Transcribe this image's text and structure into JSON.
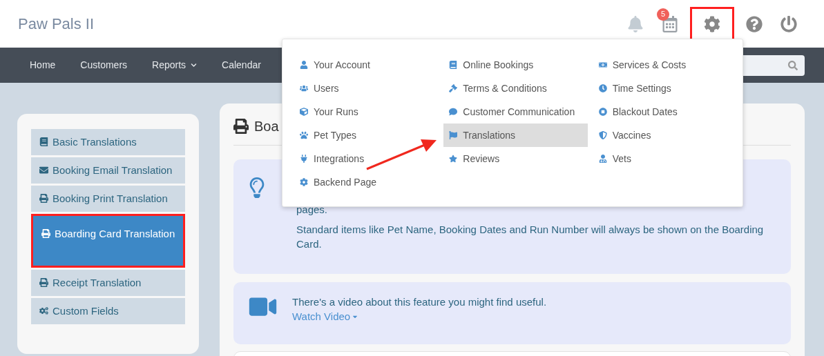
{
  "brand": "Paw Pals II",
  "header_icons": [
    {
      "kind": "bell",
      "highlighted": false
    },
    {
      "kind": "calendar",
      "badge": "5",
      "highlighted": false
    },
    {
      "kind": "gear",
      "highlighted": true
    },
    {
      "kind": "help",
      "highlighted": false
    },
    {
      "kind": "power",
      "highlighted": false
    }
  ],
  "nav": [
    {
      "label": "Home",
      "has_caret": false
    },
    {
      "label": "Customers",
      "has_caret": false
    },
    {
      "label": "Reports",
      "has_caret": true
    },
    {
      "label": "Calendar",
      "has_caret": false
    }
  ],
  "settings_menu": {
    "columns": [
      [
        {
          "label": "Your Account",
          "selected": false
        },
        {
          "label": "Users",
          "selected": false
        },
        {
          "label": "Your Runs",
          "selected": false
        },
        {
          "label": "Pet Types",
          "selected": false
        },
        {
          "label": "Integrations",
          "selected": false
        },
        {
          "label": "Backend Page",
          "selected": false
        }
      ],
      [
        {
          "label": "Online Bookings",
          "selected": false
        },
        {
          "label": "Terms & Conditions",
          "selected": false
        },
        {
          "label": "Customer Communication",
          "selected": false
        },
        {
          "label": "Translations",
          "selected": true
        },
        {
          "label": "Reviews",
          "selected": false
        }
      ],
      [
        {
          "label": "Services & Costs",
          "selected": false
        },
        {
          "label": "Time Settings",
          "selected": false
        },
        {
          "label": "Blackout Dates",
          "selected": false
        },
        {
          "label": "Vaccines",
          "selected": false
        },
        {
          "label": "Vets",
          "selected": false
        }
      ]
    ]
  },
  "sidebar": {
    "items": [
      {
        "label": "Basic Translations",
        "selected": false,
        "highlighted": false
      },
      {
        "label": "Booking Email Translation",
        "selected": false,
        "highlighted": false
      },
      {
        "label": "Booking Print Translation",
        "selected": false,
        "highlighted": false
      },
      {
        "label": "Boarding Card Translation",
        "selected": true,
        "highlighted": true
      },
      {
        "label": "Receipt Translation",
        "selected": false,
        "highlighted": false
      },
      {
        "label": "Custom Fields",
        "selected": false,
        "highlighted": false
      }
    ]
  },
  "main": {
    "title": "Boa",
    "tip": {
      "paragraphs": [
        "pages.",
        "Standard items like Pet Name, Booking Dates and Run Number will always be shown on the Boarding Card."
      ]
    },
    "video": {
      "text": "There's a video about this feature you might find useful.",
      "link": "Watch Video"
    }
  }
}
